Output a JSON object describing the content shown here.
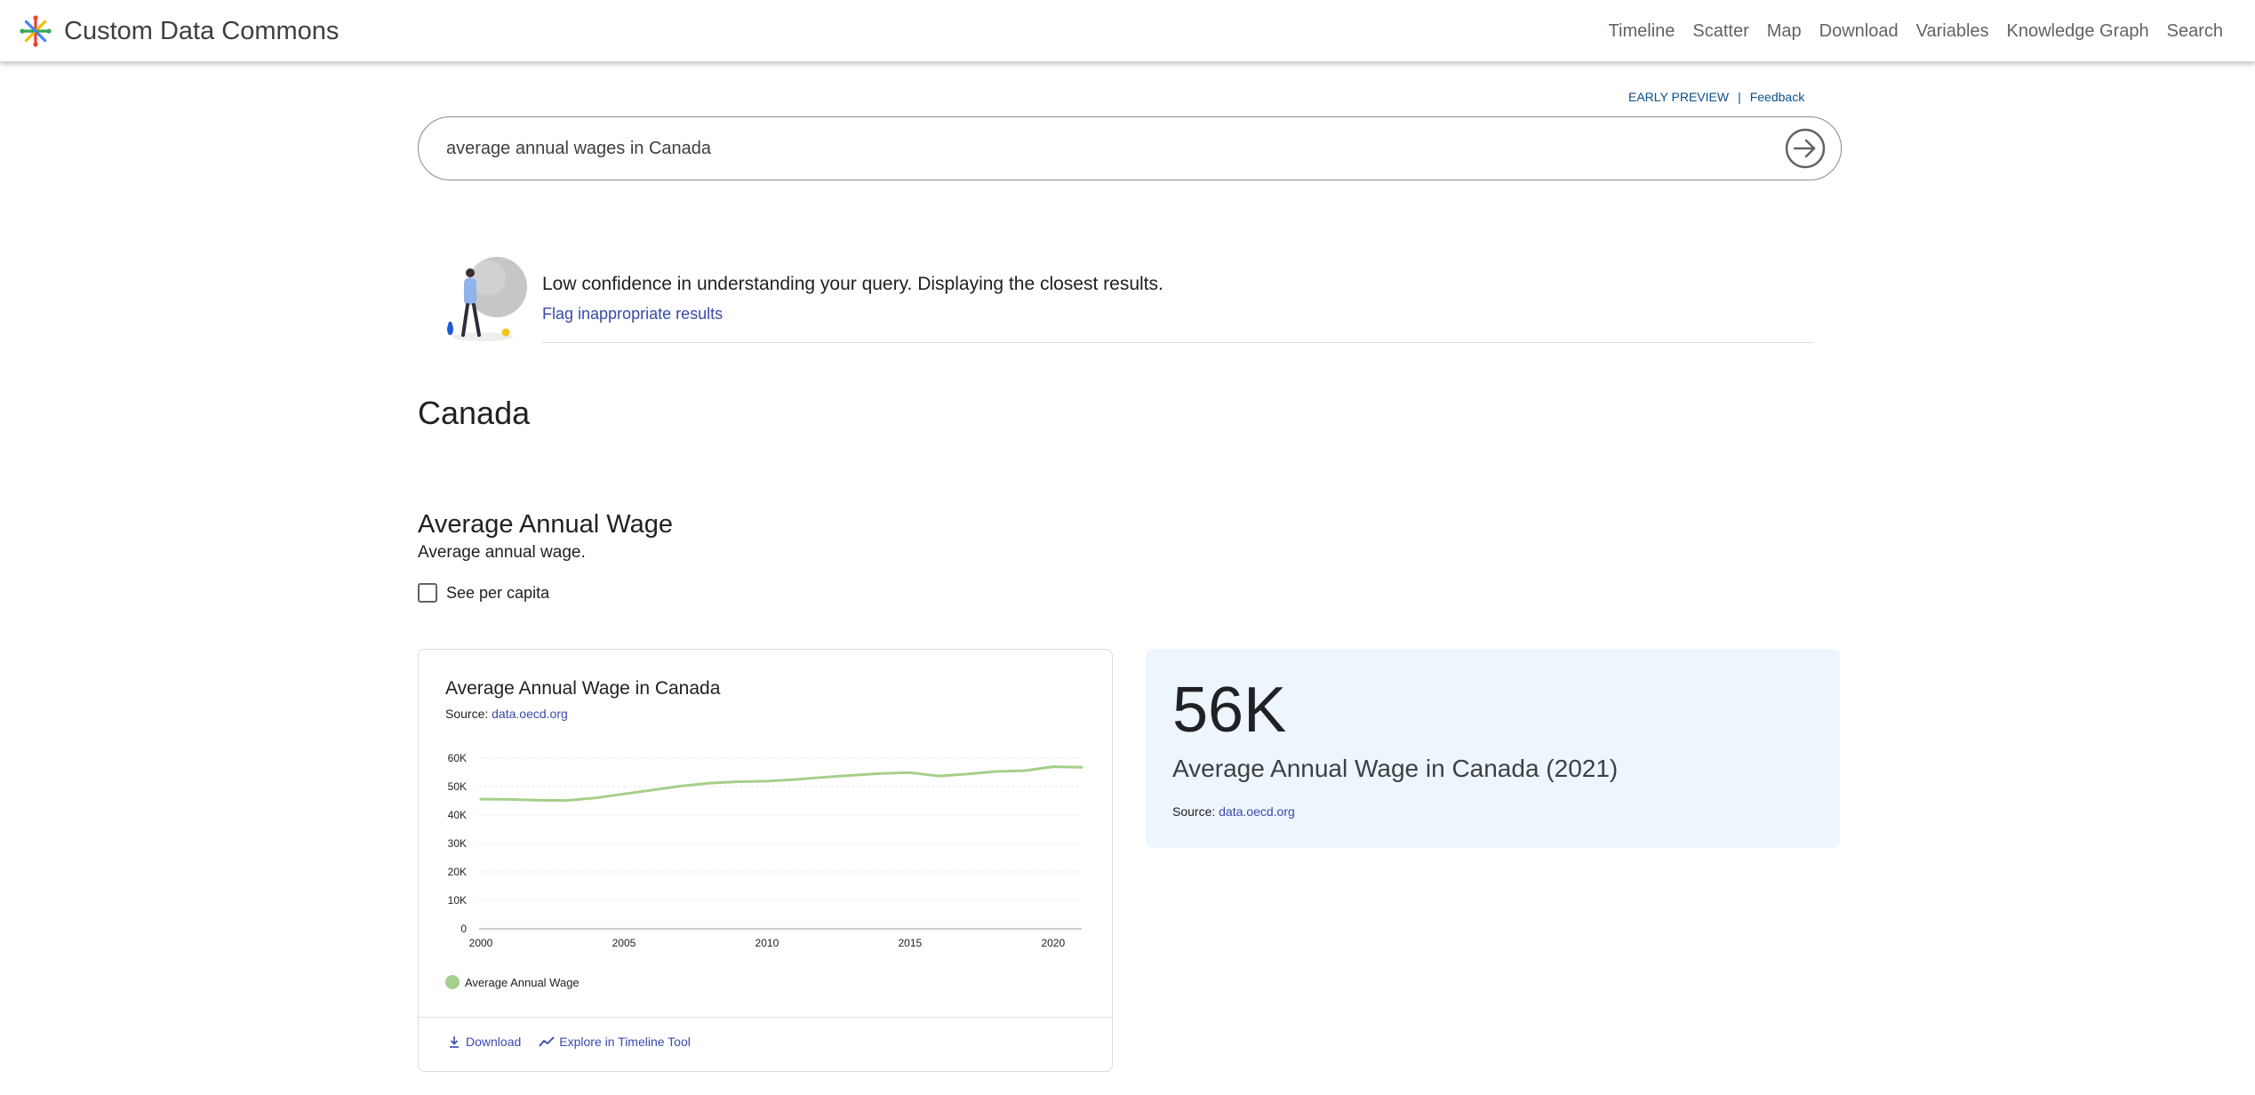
{
  "header": {
    "brand": "Custom Data Commons",
    "nav": [
      "Timeline",
      "Scatter",
      "Map",
      "Download",
      "Variables",
      "Knowledge Graph",
      "Search"
    ]
  },
  "preview": {
    "label": "EARLY PREVIEW",
    "separator": "|",
    "feedback": "Feedback"
  },
  "search": {
    "value": "average annual wages in Canada"
  },
  "confidence": {
    "message": "Low confidence in understanding your query. Displaying the closest results.",
    "flag_link": "Flag inappropriate results"
  },
  "place": {
    "title": "Canada"
  },
  "block": {
    "title": "Average Annual Wage",
    "description": "Average annual wage.",
    "per_capita_label": "See per capita"
  },
  "chart_card": {
    "title": "Average Annual Wage in Canada",
    "source_label": "Source:",
    "source_link": "data.oecd.org",
    "download": "Download",
    "explore": "Explore in Timeline Tool"
  },
  "chart_data": {
    "type": "line",
    "title": "Average Annual Wage in Canada",
    "xlabel": "",
    "ylabel": "",
    "ylim": [
      0,
      60000
    ],
    "xlim": [
      2000,
      2021
    ],
    "y_ticks": [
      "0",
      "10K",
      "20K",
      "30K",
      "40K",
      "50K",
      "60K"
    ],
    "x_ticks": [
      "2000",
      "2005",
      "2010",
      "2015",
      "2020"
    ],
    "grid": true,
    "legend_position": "bottom-left",
    "series": [
      {
        "name": "Average Annual Wage",
        "color": "#a5cf8a",
        "x": [
          2000,
          2001,
          2002,
          2003,
          2004,
          2005,
          2006,
          2007,
          2008,
          2009,
          2010,
          2011,
          2012,
          2013,
          2014,
          2015,
          2016,
          2017,
          2018,
          2019,
          2020,
          2021
        ],
        "values": [
          45600,
          45500,
          45200,
          45100,
          46000,
          47400,
          48800,
          50200,
          51200,
          51700,
          51900,
          52500,
          53300,
          54000,
          54600,
          54900,
          53700,
          54400,
          55300,
          55600,
          57000,
          56800
        ]
      }
    ]
  },
  "highlight": {
    "value": "56K",
    "description": "Average Annual Wage in Canada (2021)",
    "source_label": "Source:",
    "source_link": "data.oecd.org"
  }
}
